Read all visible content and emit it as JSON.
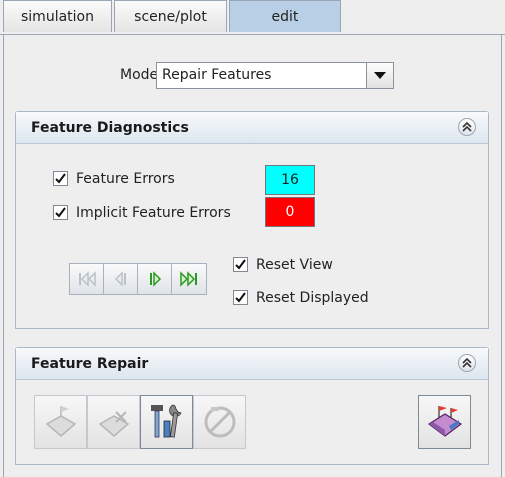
{
  "tabs": [
    {
      "label": "simulation"
    },
    {
      "label": "scene/plot"
    },
    {
      "label": "edit"
    }
  ],
  "mode": {
    "label": "Mode",
    "selected": "Repair Features"
  },
  "diagnostics": {
    "title": "Feature Diagnostics",
    "feature_errors": {
      "label": "Feature Errors",
      "checked": true,
      "count": "16",
      "color": "#00ffff"
    },
    "implicit_errors": {
      "label": "Implicit Feature Errors",
      "checked": true,
      "count": "0",
      "color": "#ff0000"
    },
    "reset_view": {
      "label": "Reset View",
      "checked": true
    },
    "reset_displayed": {
      "label": "Reset Displayed",
      "checked": true
    },
    "player_icons": [
      "first-icon",
      "previous-icon",
      "next-icon",
      "last-icon"
    ]
  },
  "repair": {
    "title": "Feature Repair",
    "tools": [
      "fill-surface-icon",
      "delete-feature-icon",
      "repair-tools-icon",
      "disabled-tool-icon",
      "close-feature-icon"
    ]
  },
  "colors": {
    "active_tab": "#b8cfe5",
    "accent_green": "#2b9a22"
  }
}
